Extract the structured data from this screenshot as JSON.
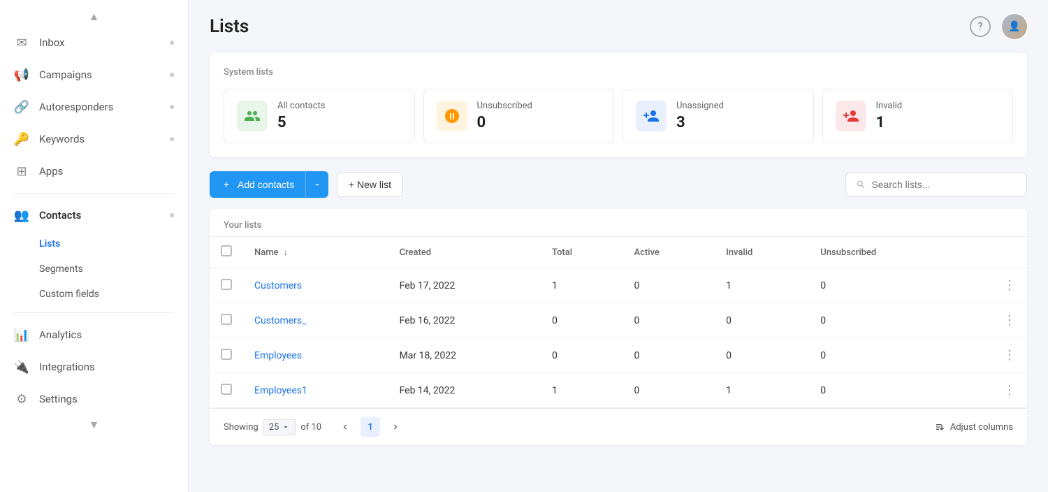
{
  "page": {
    "title": "Lists"
  },
  "sidebar": {
    "scroll_up": "▲",
    "items": [
      {
        "id": "inbox",
        "label": "Inbox",
        "icon": "✉",
        "hasDot": true
      },
      {
        "id": "campaigns",
        "label": "Campaigns",
        "icon": "📢",
        "hasDot": true
      },
      {
        "id": "autoresponders",
        "label": "Autoresponders",
        "icon": "🔗",
        "hasDot": true
      },
      {
        "id": "keywords",
        "label": "Keywords",
        "icon": "🔑",
        "hasDot": true
      },
      {
        "id": "apps",
        "label": "Apps",
        "icon": "⊞",
        "hasDot": false
      },
      {
        "id": "contacts",
        "label": "Contacts",
        "icon": "👥",
        "hasDot": true,
        "active": true
      },
      {
        "id": "analytics",
        "label": "Analytics",
        "icon": "📊",
        "hasDot": false
      },
      {
        "id": "integrations",
        "label": "Integrations",
        "icon": "🔌",
        "hasDot": false
      },
      {
        "id": "settings",
        "label": "Settings",
        "icon": "⚙",
        "hasDot": false
      }
    ],
    "sub_items": [
      {
        "id": "lists",
        "label": "Lists",
        "active": true
      },
      {
        "id": "segments",
        "label": "Segments",
        "active": false
      },
      {
        "id": "custom-fields",
        "label": "Custom fields",
        "active": false
      }
    ],
    "scroll_down": "▼"
  },
  "system_lists": {
    "label": "System lists",
    "cards": [
      {
        "id": "all-contacts",
        "name": "All contacts",
        "value": "5",
        "icon_color": "green",
        "icon": "👥"
      },
      {
        "id": "unsubscribed",
        "name": "Unsubscribed",
        "value": "0",
        "icon_color": "orange",
        "icon": "🚫"
      },
      {
        "id": "unassigned",
        "name": "Unassigned",
        "value": "3",
        "icon_color": "blue",
        "icon": "➕"
      },
      {
        "id": "invalid",
        "name": "Invalid",
        "value": "1",
        "icon_color": "red",
        "icon": "❌"
      }
    ]
  },
  "toolbar": {
    "add_contacts_label": "Add contacts",
    "new_list_label": "+ New list",
    "search_placeholder": "Search lists..."
  },
  "your_lists": {
    "label": "Your lists",
    "columns": [
      "Name",
      "Created",
      "Total",
      "Active",
      "Invalid",
      "Unsubscribed"
    ],
    "rows": [
      {
        "id": 1,
        "name": "Customers",
        "created": "Feb 17, 2022",
        "total": "1",
        "active": "0",
        "invalid": "1",
        "unsubscribed": "0"
      },
      {
        "id": 2,
        "name": "Customers_",
        "created": "Feb 16, 2022",
        "total": "0",
        "active": "0",
        "invalid": "0",
        "unsubscribed": "0"
      },
      {
        "id": 3,
        "name": "Employees",
        "created": "Mar 18, 2022",
        "total": "0",
        "active": "0",
        "invalid": "0",
        "unsubscribed": "0"
      },
      {
        "id": 4,
        "name": "Employees1",
        "created": "Feb 14, 2022",
        "total": "1",
        "active": "0",
        "invalid": "1",
        "unsubscribed": "0"
      }
    ]
  },
  "footer": {
    "showing_label": "Showing",
    "per_page": "25",
    "of_label": "of 10",
    "page": "1",
    "adjust_columns_label": "Adjust columns"
  }
}
